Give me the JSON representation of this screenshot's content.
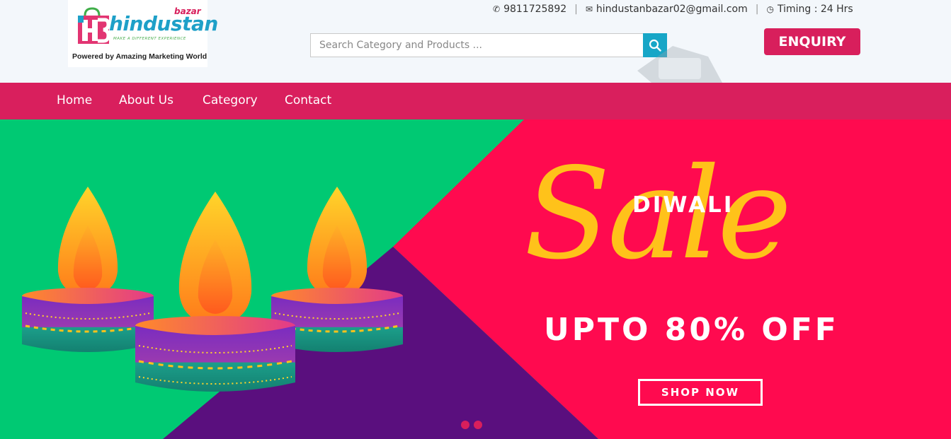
{
  "logo": {
    "hb": "HB",
    "bazar": "bazar",
    "name": "hindustan",
    "tagline": "MAKE A DIFFERENT EXPERIENCE",
    "powered": "Powered by Amazing Marketing World"
  },
  "contact": {
    "phone_icon": "phone-icon",
    "phone": "9811725892",
    "email_icon": "envelope-icon",
    "email": "hindustanbazar02@gmail.com",
    "clock_icon": "clock-icon",
    "timing": "Timing : 24 Hrs",
    "separator": "|"
  },
  "search": {
    "placeholder": "Search Category and Products ...",
    "value": "",
    "icon": "search-icon"
  },
  "enquiry_label": "ENQUIRY",
  "nav": {
    "items": [
      "Home",
      "About Us",
      "Category",
      "Contact"
    ]
  },
  "hero": {
    "title_top": "DIWALI",
    "title_script": "Sale",
    "offer": "UPTO 80% OFF",
    "cta": "SHOP NOW",
    "slides": 2,
    "active_slide": 1
  },
  "colors": {
    "brand_pink": "#d91f5d",
    "accent_cyan": "#17a6c7",
    "hero_green": "#00c973",
    "hero_purple": "#5a0f7e",
    "hero_red": "#ff0a4f",
    "hero_gold": "#ffc21a"
  }
}
